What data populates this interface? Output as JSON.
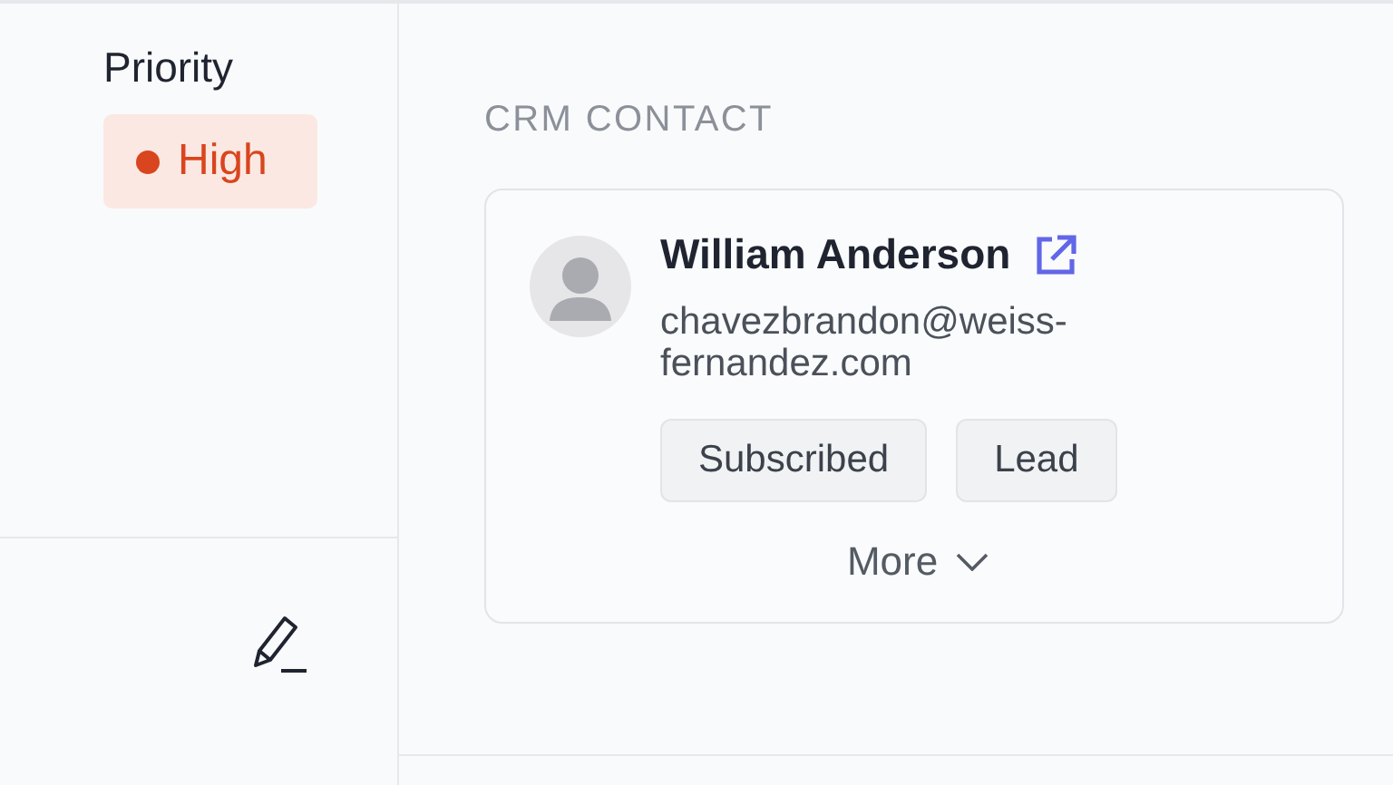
{
  "priority": {
    "label": "Priority",
    "value": "High",
    "color": "#d9451e"
  },
  "crm_contact": {
    "heading": "CRM CONTACT",
    "name": "William Anderson",
    "email": "chavezbrandon@weiss-fernandez.com",
    "tags": [
      "Subscribed",
      "Lead"
    ],
    "more": "More"
  }
}
